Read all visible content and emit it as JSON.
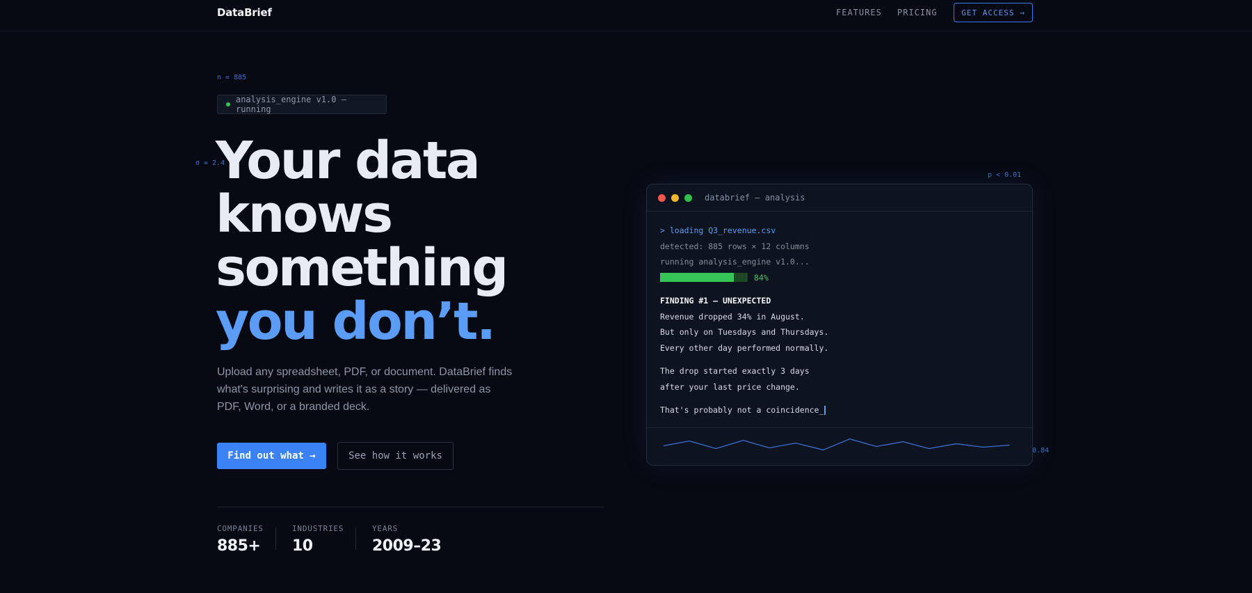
{
  "nav": {
    "logo": "DataBrief",
    "links": [
      "FEATURES",
      "PRICING"
    ],
    "cta": "GET ACCESS →"
  },
  "annotations": {
    "n": "n = 885",
    "sigma": "σ = 2.4",
    "p": "p < 0.01",
    "r": "0.84"
  },
  "badge": {
    "text": "analysis_engine v1.0 — running"
  },
  "hero": {
    "line1": "Your data",
    "line2": "knows",
    "line3": "something",
    "accent": "you don’t.",
    "description": "Upload any spreadsheet, PDF, or document. DataBrief finds what's surprising and writes it as a story — delivered as PDF, Word, or a branded deck.",
    "primary_button": "Find out what →",
    "secondary_button": "See how it works"
  },
  "stats": [
    {
      "label": "COMPANIES",
      "value": "885+"
    },
    {
      "label": "INDUSTRIES",
      "value": "10"
    },
    {
      "label": "YEARS",
      "value": "2009–23"
    }
  ],
  "terminal": {
    "title": "databrief — analysis",
    "lines": {
      "cmd": "> loading Q3_revenue.csv",
      "detected": "detected: 885 rows × 12 columns",
      "running": "running analysis_engine v1.0...",
      "finding": "FINDING #1 — UNEXPECTED",
      "f1": "Revenue dropped 34% in August.",
      "f2": "But only on Tuesdays and Thursdays.",
      "f3": "Every other day performed normally.",
      "f4": "The drop started exactly 3 days",
      "f5": "after your last price change.",
      "f6": "That's probably not a coincidence_"
    },
    "progress": {
      "value": 0.84,
      "label": "84%"
    },
    "colors": {
      "accent": "#5b9cf6",
      "progress": "#35c455"
    }
  }
}
